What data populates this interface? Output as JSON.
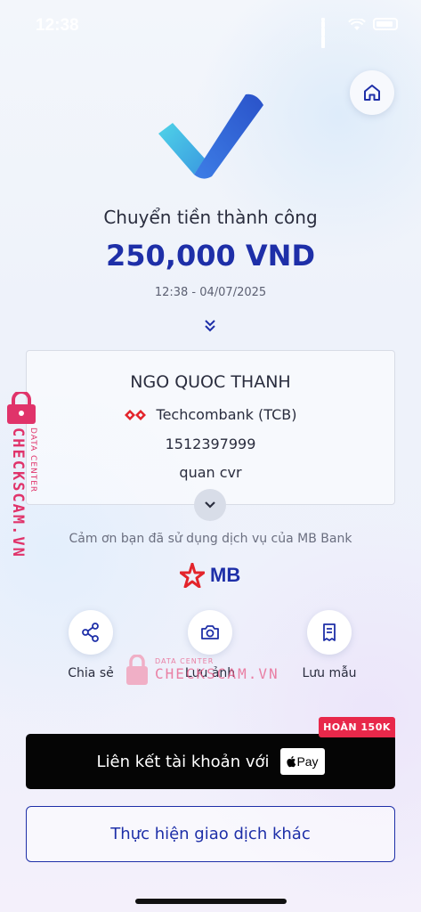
{
  "status_bar": {
    "time": "12:38"
  },
  "header": {
    "home_icon": "home-icon"
  },
  "result": {
    "title": "Chuyển tiền thành công",
    "amount": "250,000 VND",
    "datetime": "12:38 - 04/07/2025"
  },
  "recipient": {
    "name": "NGO QUOC THANH",
    "bank": "Techcombank (TCB)",
    "account": "1512397999",
    "memo": "quan cvr"
  },
  "footer": {
    "thanks": "Cảm ơn bạn đã sử dụng dịch vụ của MB Bank",
    "brand": "MB"
  },
  "actions": [
    {
      "label": "Chia sẻ",
      "icon": "share-icon"
    },
    {
      "label": "Lưu ảnh",
      "icon": "camera-icon"
    },
    {
      "label": "Lưu mẫu",
      "icon": "receipt-icon"
    }
  ],
  "watermark": {
    "small": "DATA CENTER",
    "big": "CHECKSCAM.VN"
  },
  "promo": {
    "badge": "HOÀN 150K",
    "link_label": "Liên kết tài khoản với",
    "apple_pay": "Pay"
  },
  "other_button": "Thực hiện giao dịch khác",
  "colors": {
    "primary": "#1e2fa8",
    "badge": "#e8284a",
    "watermark": "#e0336a"
  }
}
